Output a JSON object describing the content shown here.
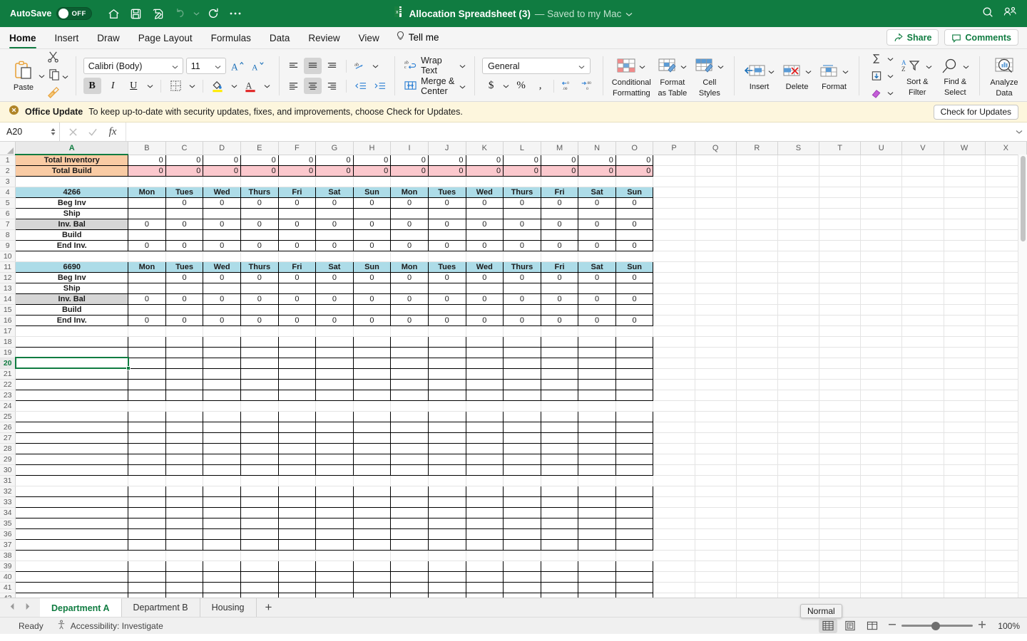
{
  "titlebar": {
    "autosave_label": "AutoSave",
    "autosave_state": "OFF",
    "doc_title": "Allocation Spreadsheet (3)",
    "doc_status": "— Saved to my Mac",
    "icons": [
      "home-icon",
      "save-icon",
      "save-as-icon",
      "undo-icon",
      "redo-icon",
      "more-icon"
    ],
    "right_icons": [
      "search-icon",
      "collaborators-icon"
    ]
  },
  "ribbon_tabs": {
    "tabs": [
      "Home",
      "Insert",
      "Draw",
      "Page Layout",
      "Formulas",
      "Data",
      "Review",
      "View"
    ],
    "active": "Home",
    "tell_me": "Tell me",
    "share_label": "Share",
    "comments_label": "Comments"
  },
  "ribbon": {
    "paste_label": "Paste",
    "font_name": "Calibri (Body)",
    "font_size": "11",
    "wrap_text": "Wrap Text",
    "merge_center": "Merge & Center",
    "number_format": "General",
    "conditional_formatting": "Conditional\nFormatting",
    "conditional_formatting_l1": "Conditional",
    "conditional_formatting_l2": "Formatting",
    "format_as_table_l1": "Format",
    "format_as_table_l2": "as Table",
    "cell_styles_l1": "Cell",
    "cell_styles_l2": "Styles",
    "insert_label": "Insert",
    "delete_label": "Delete",
    "format_label": "Format",
    "sort_filter_l1": "Sort &",
    "sort_filter_l2": "Filter",
    "find_select_l1": "Find &",
    "find_select_l2": "Select",
    "analyze_data_l1": "Analyze",
    "analyze_data_l2": "Data"
  },
  "update_bar": {
    "title": "Office Update",
    "message": "To keep up-to-date with security updates, fixes, and improvements, choose Check for Updates.",
    "button": "Check for Updates"
  },
  "formula_bar": {
    "name_box": "A20",
    "formula_value": "",
    "cancel_icon": "cancel-icon",
    "confirm_icon": "confirm-icon",
    "function_icon": "fx-icon"
  },
  "sheet": {
    "columns": [
      "A",
      "B",
      "C",
      "D",
      "E",
      "F",
      "G",
      "H",
      "I",
      "J",
      "K",
      "L",
      "M",
      "N",
      "O",
      "P",
      "Q",
      "R",
      "S",
      "T",
      "U",
      "V",
      "W",
      "X"
    ],
    "selected_column": "A",
    "selected_cell": "A20",
    "row_count": 42,
    "table_data": {
      "summary": [
        {
          "label": "Total Inventory",
          "values": [
            "0",
            "0",
            "0",
            "0",
            "0",
            "0",
            "0",
            "0",
            "0",
            "0",
            "0",
            "0",
            "0",
            "0"
          ]
        },
        {
          "label": "Total Build",
          "values": [
            "0",
            "0",
            "0",
            "0",
            "0",
            "0",
            "0",
            "0",
            "0",
            "0",
            "0",
            "0",
            "0",
            "0"
          ]
        }
      ],
      "day_headers": [
        "Mon",
        "Tues",
        "Wed",
        "Thurs",
        "Fri",
        "Sat",
        "Sun",
        "Mon",
        "Tues",
        "Wed",
        "Thurs",
        "Fri",
        "Sat",
        "Sun"
      ],
      "blocks": [
        {
          "title": "4266",
          "rows": [
            {
              "label": "Beg Inv",
              "values": [
                "",
                "0",
                "0",
                "0",
                "0",
                "0",
                "0",
                "0",
                "0",
                "0",
                "0",
                "0",
                "0",
                "0"
              ]
            },
            {
              "label": "Ship",
              "values": [
                "",
                "",
                "",
                "",
                "",
                "",
                "",
                "",
                "",
                "",
                "",
                "",
                "",
                ""
              ]
            },
            {
              "label": "Inv. Bal",
              "values": [
                "0",
                "0",
                "0",
                "0",
                "0",
                "0",
                "0",
                "0",
                "0",
                "0",
                "0",
                "0",
                "0",
                "0"
              ]
            },
            {
              "label": "Build",
              "values": [
                "",
                "",
                "",
                "",
                "",
                "",
                "",
                "",
                "",
                "",
                "",
                "",
                "",
                ""
              ]
            },
            {
              "label": "End Inv.",
              "values": [
                "0",
                "0",
                "0",
                "0",
                "0",
                "0",
                "0",
                "0",
                "0",
                "0",
                "0",
                "0",
                "0",
                "0"
              ]
            }
          ]
        },
        {
          "title": "6690",
          "rows": [
            {
              "label": "Beg Inv",
              "values": [
                "",
                "0",
                "0",
                "0",
                "0",
                "0",
                "0",
                "0",
                "0",
                "0",
                "0",
                "0",
                "0",
                "0"
              ]
            },
            {
              "label": "Ship",
              "values": [
                "",
                "",
                "",
                "",
                "",
                "",
                "",
                "",
                "",
                "",
                "",
                "",
                "",
                ""
              ]
            },
            {
              "label": "Inv. Bal",
              "values": [
                "0",
                "0",
                "0",
                "0",
                "0",
                "0",
                "0",
                "0",
                "0",
                "0",
                "0",
                "0",
                "0",
                "0"
              ]
            },
            {
              "label": "Build",
              "values": [
                "",
                "",
                "",
                "",
                "",
                "",
                "",
                "",
                "",
                "",
                "",
                "",
                "",
                ""
              ]
            },
            {
              "label": "End Inv.",
              "values": [
                "0",
                "0",
                "0",
                "0",
                "0",
                "0",
                "0",
                "0",
                "0",
                "0",
                "0",
                "0",
                "0",
                "0"
              ]
            }
          ]
        }
      ]
    },
    "colors": {
      "header_orange": "#f9cba4",
      "build_pink": "#fbc8cd",
      "block_blue": "#addce8",
      "inv_bal_gray": "#d6d6d6",
      "selection_green": "#107c41",
      "red_text": "#d31b1b"
    }
  },
  "sheet_tabs": {
    "tabs": [
      "Department A",
      "Department B",
      "Housing"
    ],
    "active": "Department A",
    "add_label": "+"
  },
  "status_bar": {
    "ready": "Ready",
    "accessibility": "Accessibility: Investigate",
    "tooltip": "Normal",
    "zoom": "100%",
    "view_buttons": [
      "normal-view-icon",
      "page-layout-view-icon",
      "page-break-view-icon"
    ]
  }
}
